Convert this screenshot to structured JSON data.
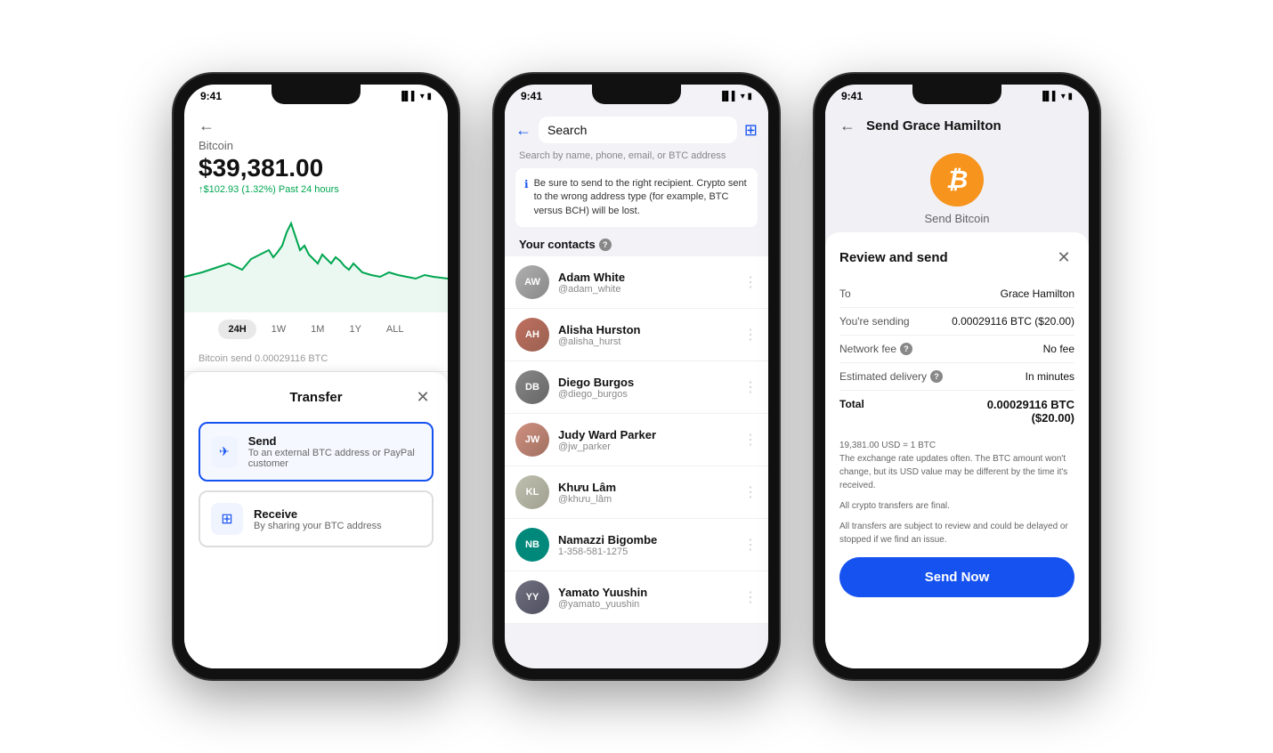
{
  "phone1": {
    "status_time": "9:41",
    "back_icon": "←",
    "label": "Bitcoin",
    "price": "$39,381.00",
    "change": "↑$102.93 (1.32%) Past 24 hours",
    "time_filters": [
      "24H",
      "1W",
      "1M",
      "1Y",
      "ALL"
    ],
    "active_filter": "24H",
    "bottom_info": "Bitcoin send       0.00029116 BTC",
    "modal": {
      "title": "Transfer",
      "close": "✕",
      "options": [
        {
          "icon": "✈",
          "label": "Send",
          "description": "To an external BTC address or PayPal customer",
          "selected": true
        },
        {
          "icon": "⊞",
          "label": "Receive",
          "description": "By sharing your BTC address",
          "selected": false
        }
      ]
    }
  },
  "phone2": {
    "status_time": "9:41",
    "back_icon": "←",
    "search_placeholder": "Search",
    "search_hint": "Search by name, phone, email, or BTC address",
    "qr_icon": "⊞",
    "warning": "Be sure to send to the right recipient. Crypto sent to the wrong address type (for example, BTC versus BCH) will be lost.",
    "section_title": "Your contacts",
    "contacts": [
      {
        "name": "Adam White",
        "handle": "@adam_white",
        "initials": "AW",
        "color": "av-photo"
      },
      {
        "name": "Alisha Hurston",
        "handle": "@alisha_hurst",
        "initials": "AH",
        "color": "av-photo"
      },
      {
        "name": "Diego Burgos",
        "handle": "@diego_burgos",
        "initials": "DB",
        "color": "av-photo"
      },
      {
        "name": "Judy Ward Parker",
        "handle": "@jw_parker",
        "initials": "JW",
        "color": "av-photo"
      },
      {
        "name": "Khưu Lâm",
        "handle": "@khưu_lâm",
        "initials": "KL",
        "color": "av-photo"
      },
      {
        "name": "Namazzi Bigombe",
        "handle": "1-358-581-1275",
        "initials": "NB",
        "color": "nb-avatar"
      },
      {
        "name": "Yamato Yuushin",
        "handle": "@yamato_yuushin",
        "initials": "YY",
        "color": "av-photo"
      }
    ]
  },
  "phone3": {
    "status_time": "9:41",
    "back_icon": "←",
    "title": "Send Grace Hamilton",
    "btc_symbol": "₿",
    "hero_label": "Send Bitcoin",
    "modal": {
      "title": "Review and send",
      "close": "✕",
      "rows": [
        {
          "label": "To",
          "value": "Grace Hamilton",
          "bold": false,
          "has_info": false
        },
        {
          "label": "You're sending",
          "value": "0.00029116 BTC ($20.00)",
          "bold": false,
          "has_info": false
        },
        {
          "label": "Network fee",
          "value": "No fee",
          "bold": false,
          "has_info": true
        },
        {
          "label": "Estimated delivery",
          "value": "In minutes",
          "bold": false,
          "has_info": true
        },
        {
          "label": "Total",
          "value": "0.00029116 BTC ($20.00)",
          "bold": true,
          "has_info": false
        }
      ],
      "notes": [
        "19,381.00 USD = 1 BTC",
        "The exchange rate updates often. The BTC amount won't change, but its USD value may be different by the time it's received.",
        "",
        "All crypto transfers are final.",
        "",
        "All transfers are subject to review and could be delayed or stopped if we find an issue."
      ],
      "send_button": "Send Now"
    }
  }
}
